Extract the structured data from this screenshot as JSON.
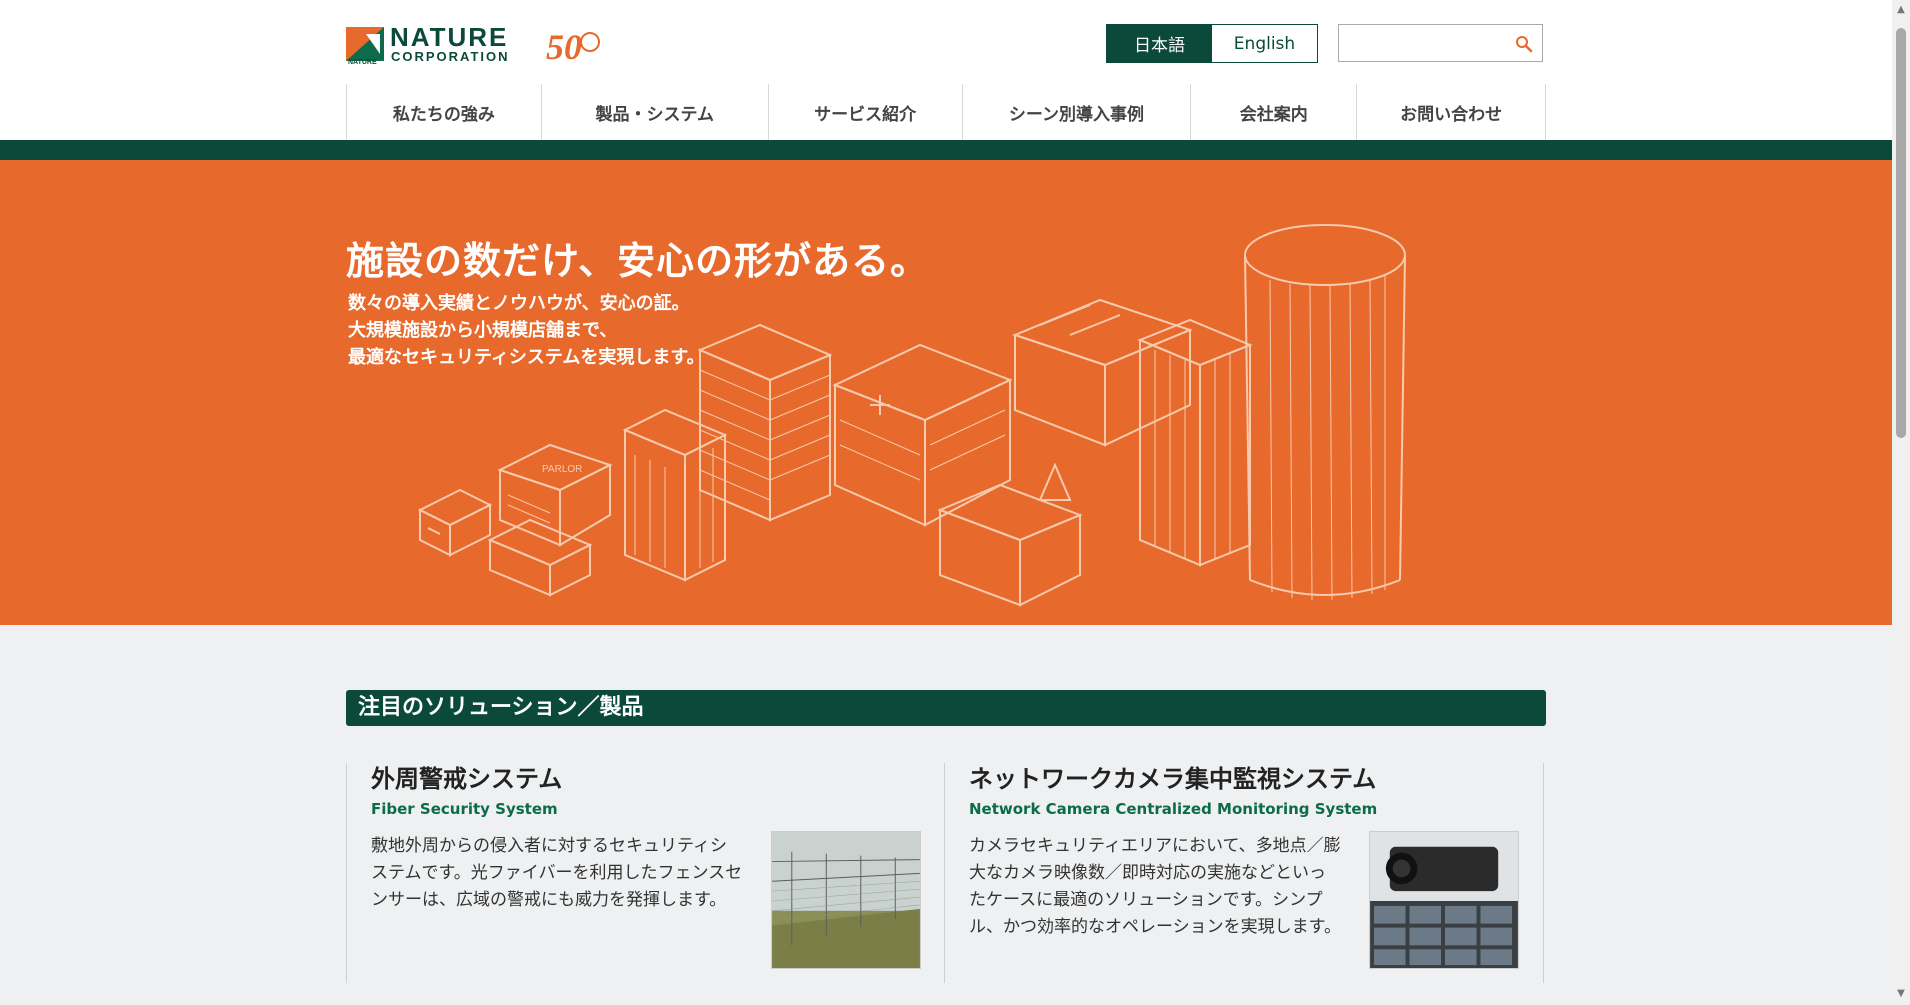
{
  "header": {
    "logo_line1": "NATURE",
    "logo_line2": "CORPORATION",
    "logo_badge_small": "NATURE",
    "anniversary_mark": "50",
    "lang_ja": "日本語",
    "lang_en": "English",
    "search_placeholder": ""
  },
  "nav": {
    "items": [
      {
        "label": "私たちの強み"
      },
      {
        "label": "製品・システム"
      },
      {
        "label": "サービス紹介"
      },
      {
        "label": "シーン別導入事例"
      },
      {
        "label": "会社案内"
      },
      {
        "label": "お問い合わせ"
      }
    ]
  },
  "hero": {
    "title": "施設の数だけ、安心の形がある。",
    "sub_lines": [
      "数々の導入実績とノウハウが、安心の証。",
      "大規模施設から小規模店舗まで、",
      "最適なセキュリティシステムを実現します。"
    ],
    "building_sign": "PARLOR"
  },
  "section": {
    "title": "注目のソリューション／製品"
  },
  "cards": [
    {
      "title": "外周警戒システム",
      "en": "Fiber Security System",
      "desc": "敷地外周からの侵入者に対するセキュリティシステムです。光ファイバーを利用したフェンスセンサーは、広域の警戒にも威力を発揮します。"
    },
    {
      "title": "ネットワークカメラ集中監視システム",
      "en": "Network Camera Centralized Monitoring System",
      "desc": "カメラセキュリティエリアにおいて、多地点／膨大なカメラ映像数／即時対応の実施などといったケースに最適のソリューションです。シンプル、かつ効率的なオペレーションを実現します。"
    }
  ],
  "colors": {
    "brand_green": "#0b4a3a",
    "hero_orange": "#e8692c",
    "accent_green_text": "#0b6b4a"
  },
  "icons": {
    "search": "search-icon",
    "scroll_up": "chevron-up-icon",
    "scroll_down": "chevron-down-icon"
  }
}
